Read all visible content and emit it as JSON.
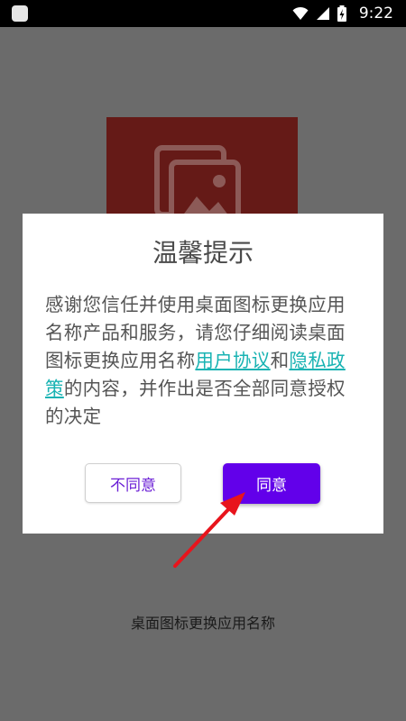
{
  "status_bar": {
    "time": "9:22",
    "icons": [
      "app-notification-icon",
      "wifi-icon",
      "signal-icon",
      "battery-charging-icon"
    ]
  },
  "background": {
    "app_name": "桌面图标更换应用名称",
    "splash_icon": "image-gallery-icon",
    "splash_color": "#651a17"
  },
  "dialog": {
    "title": "温馨提示",
    "message_before": "感谢您信任并使用桌面图标更换应用名称产品和服务，请您仔细阅读桌面图标更换应用名称",
    "link_user_agreement": "用户协议",
    "message_and": "和",
    "link_privacy_policy": "隐私政策",
    "message_after": "的内容，并作出是否全部同意授权的决定",
    "decline_label": "不同意",
    "agree_label": "同意"
  },
  "colors": {
    "accent": "#6200ea",
    "link": "#19b3b3",
    "arrow": "#e8141c"
  }
}
